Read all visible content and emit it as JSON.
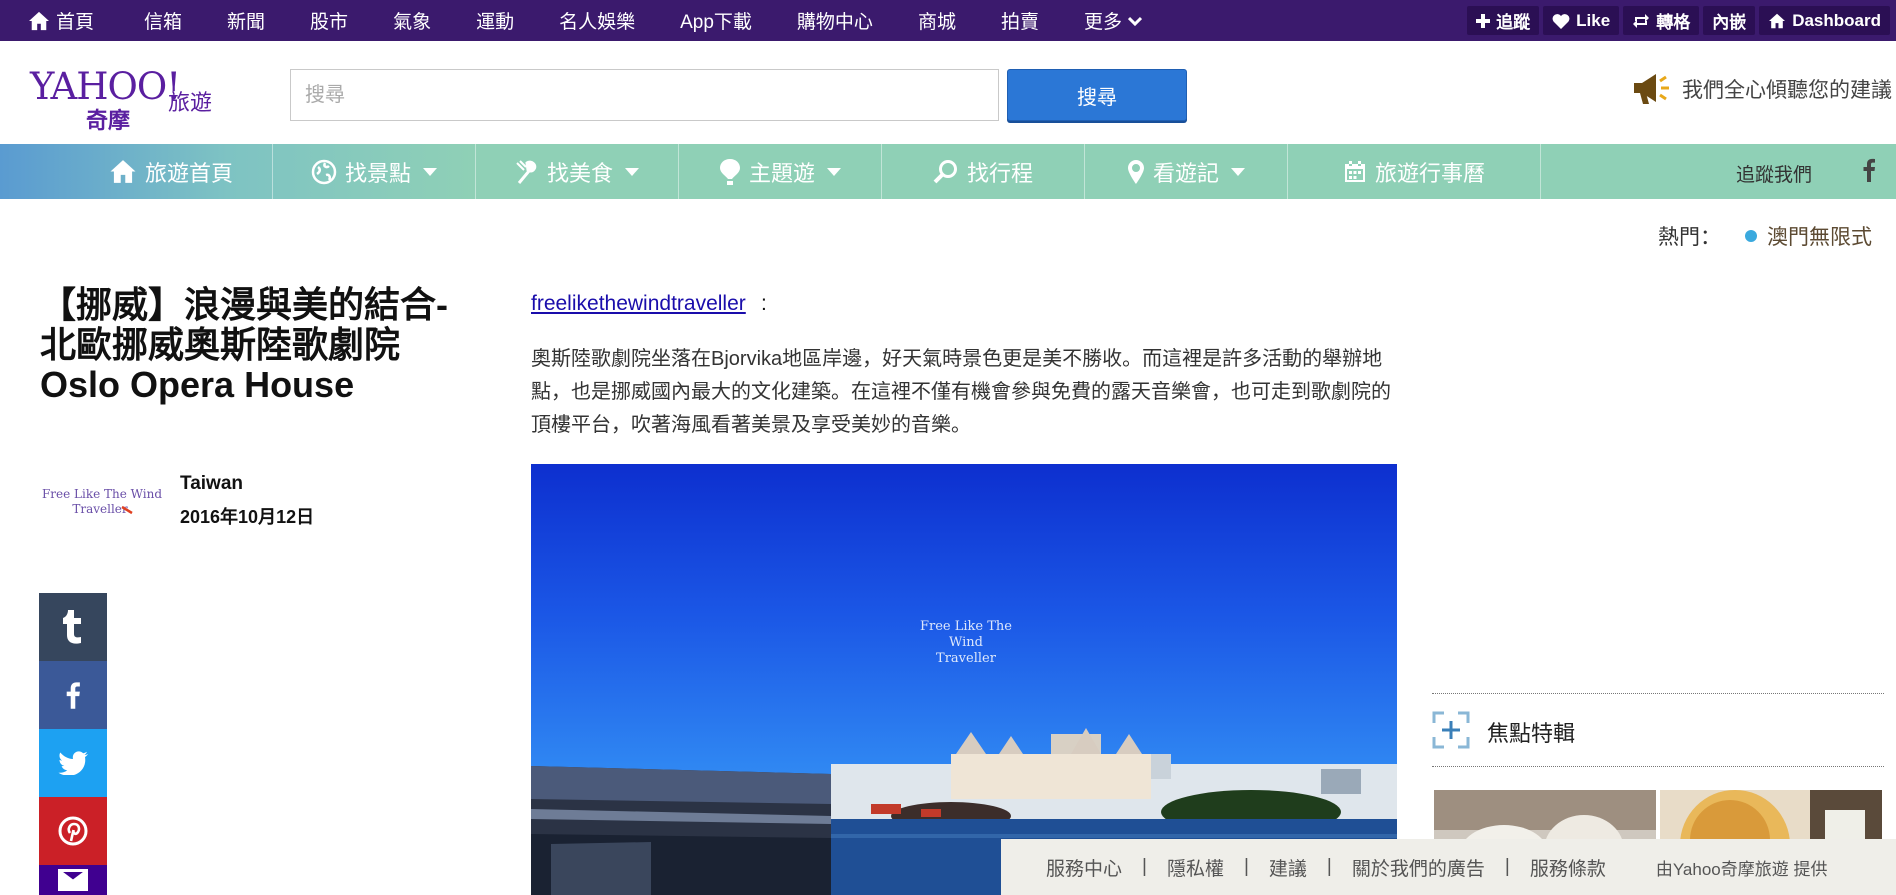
{
  "topbar": {
    "items": [
      {
        "label": "首頁",
        "icon": "home-icon"
      },
      {
        "label": "信箱"
      },
      {
        "label": "新聞"
      },
      {
        "label": "股市"
      },
      {
        "label": "氣象"
      },
      {
        "label": "運動"
      },
      {
        "label": "名人娛樂"
      },
      {
        "label": "App下載"
      },
      {
        "label": "購物中心"
      },
      {
        "label": "商城"
      },
      {
        "label": "拍賣"
      },
      {
        "label": "更多",
        "icon": "chevron-down-icon"
      }
    ],
    "actions": [
      {
        "label": "追蹤",
        "icon": "plus-icon"
      },
      {
        "label": "Like",
        "icon": "heart-icon"
      },
      {
        "label": "轉格",
        "icon": "reblog-icon"
      },
      {
        "label": "內嵌"
      },
      {
        "label": "Dashboard",
        "icon": "home-icon"
      }
    ]
  },
  "header": {
    "logo_text": "YAHOO!",
    "logo_sub": "奇摩",
    "section": "旅遊",
    "search_placeholder": "搜尋",
    "search_button": "搜尋",
    "feedback_text": "我們全心傾聽您的建議"
  },
  "travel_nav": {
    "items": [
      {
        "label": "旅遊首頁",
        "icon": "home-icon",
        "dropdown": false
      },
      {
        "label": "找景點",
        "icon": "globe-icon",
        "dropdown": true
      },
      {
        "label": "找美食",
        "icon": "utensils-icon",
        "dropdown": true
      },
      {
        "label": "主題遊",
        "icon": "hot-air-balloon-icon",
        "dropdown": true
      },
      {
        "label": "找行程",
        "icon": "search-icon",
        "dropdown": false
      },
      {
        "label": "看遊記",
        "icon": "map-pin-icon",
        "dropdown": true
      },
      {
        "label": "旅遊行事曆",
        "icon": "calendar-icon",
        "dropdown": false
      }
    ],
    "follow_label": "追蹤我們"
  },
  "hot": {
    "label": "熱門：",
    "link": "澳門無限式"
  },
  "article": {
    "title": "【挪威】浪漫與美的結合-北歐挪威奧斯陸歌劇院 Oslo Opera House",
    "author": "Taiwan",
    "date": "2016年10月12日",
    "author_logo_line1": "Free Like The Wind",
    "author_logo_line2": "Traveller",
    "source_link": "freelikethewindtraveller",
    "source_colon": ":",
    "body": "奧斯陸歌劇院坐落在Bjorvika地區岸邊，好天氣時景色更是美不勝收。而這裡是許多活動的舉辦地點，也是挪威國內最大的文化建築。在這裡不僅有機會參與免費的露天音樂會，也可走到歌劇院的頂樓平台，吹著海風看著美景及享受美妙的音樂。",
    "photo_watermark_line1": "Free Like The Wind",
    "photo_watermark_line2": "Traveller"
  },
  "share": [
    {
      "network": "tumblr",
      "icon": "tumblr-icon",
      "color": "#36465d"
    },
    {
      "network": "facebook",
      "icon": "facebook-icon",
      "color": "#3b5998"
    },
    {
      "network": "twitter",
      "icon": "twitter-icon",
      "color": "#1da1f2"
    },
    {
      "network": "pinterest",
      "icon": "pinterest-icon",
      "color": "#cb2027"
    },
    {
      "network": "email",
      "icon": "email-icon",
      "color": "#400090"
    }
  ],
  "sidebar": {
    "focus_title": "焦點特輯"
  },
  "footer": {
    "links": [
      "服務中心",
      "隱私權",
      "建議",
      "關於我們的廣告",
      "服務條款"
    ],
    "separator": "|",
    "credit": "由Yahoo奇摩旅遊 提供"
  },
  "colors": {
    "topbar": "#3b1a6d",
    "brand_purple": "#5a1fa0",
    "search_button": "#2b77d6",
    "nav_teal": "#8fd0b6",
    "link": "#1a0dab",
    "hot_dot": "#3aa9de",
    "footer_bg": "#efeee9"
  }
}
